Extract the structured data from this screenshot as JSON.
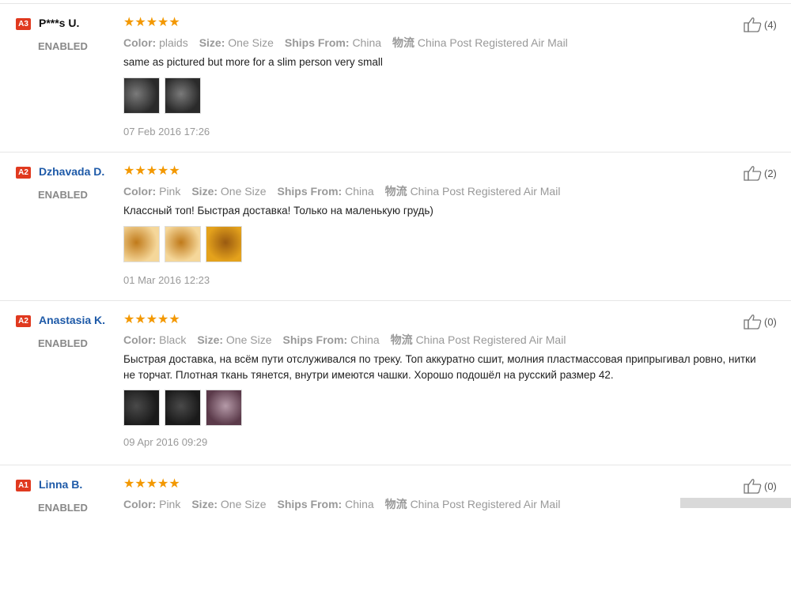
{
  "reviews": [
    {
      "badge": "A3",
      "name": "P***s U.",
      "name_color": "#111111",
      "status": "ENABLED",
      "stars": "★★★★★",
      "color_label": "Color:",
      "color_value": "plaids",
      "size_label": "Size:",
      "size_value": "One Size",
      "ships_label": "Ships From:",
      "ships_value": "China",
      "logistics_label": "物流",
      "logistics_value": "China Post Registered Air Mail",
      "text": "same as pictured but more for a slim person very small",
      "date": "07 Feb 2016 17:26",
      "likes": "(4)",
      "photos": [
        "dark",
        "dark"
      ]
    },
    {
      "badge": "A2",
      "name": "Dzhavada D.",
      "name_color": "#1e5aa8",
      "status": "ENABLED",
      "stars": "★★★★★",
      "color_label": "Color:",
      "color_value": "Pink",
      "size_label": "Size:",
      "size_value": "One Size",
      "ships_label": "Ships From:",
      "ships_value": "China",
      "logistics_label": "物流",
      "logistics_value": "China Post Registered Air Mail",
      "text": "Классный топ! Быстрая доставка! Только на маленькую грудь)",
      "date": "01 Mar 2016 12:23",
      "likes": "(2)",
      "photos": [
        "yellow",
        "yellow",
        "orange"
      ]
    },
    {
      "badge": "A2",
      "name": "Anastasia K.",
      "name_color": "#1e5aa8",
      "status": "ENABLED",
      "stars": "★★★★★",
      "color_label": "Color:",
      "color_value": "Black",
      "size_label": "Size:",
      "size_value": "One Size",
      "ships_label": "Ships From:",
      "ships_value": "China",
      "logistics_label": "物流",
      "logistics_value": "China Post Registered Air Mail",
      "text": "Быстрая доставка, на всём пути отслуживался по треку. Топ аккуратно сшит, молния пластмассовая припрыгивал ровно, нитки не торчат. Плотная ткань тянется, внутри имеются чашки. Хорошо подошёл на русский размер 42.",
      "date": "09 Apr 2016 09:29",
      "likes": "(0)",
      "photos": [
        "black",
        "black",
        "purple"
      ]
    },
    {
      "badge": "A1",
      "name": "Linna B.",
      "name_color": "#1e5aa8",
      "status": "ENABLED",
      "stars": "★★★★★",
      "color_label": "Color:",
      "color_value": "Pink",
      "size_label": "Size:",
      "size_value": "One Size",
      "ships_label": "Ships From:",
      "ships_value": "China",
      "logistics_label": "物流",
      "logistics_value": "China Post Registered Air Mail",
      "text": "",
      "date": "",
      "likes": "(0)",
      "photos": []
    }
  ],
  "colors": {
    "star": "#f39800",
    "badge": "#e0391f",
    "link_name": "#1e5aa8"
  },
  "icons": {
    "like": "thumbs-up-icon"
  }
}
